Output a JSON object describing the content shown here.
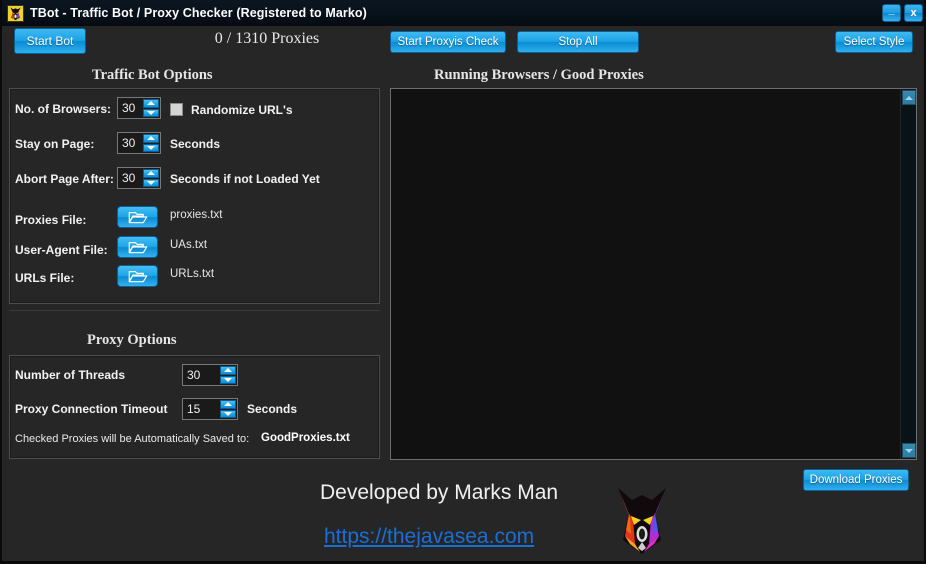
{
  "window": {
    "title": "TBot - Traffic Bot / Proxy Checker (Registered to Marko)",
    "app_icon": "wolf-logo-icon",
    "minimize_label": "_",
    "close_label": "x"
  },
  "toolbar": {
    "start_bot_label": "Start Bot",
    "proxy_counter": "0 / 1310  Proxies",
    "start_proxies_check_label": "Start Proxyis Check",
    "stop_all_label": "Stop All",
    "select_style_label": "Select Style"
  },
  "left_panel": {
    "heading": "Traffic Bot Options",
    "fields": {
      "browsers_label": "No. of Browsers:",
      "browsers_value": "30",
      "randomize_label": "Randomize URL's",
      "randomize_checked": false,
      "stay_on_page_label": "Stay on Page:",
      "stay_on_page_value": "30",
      "stay_on_page_unit": "Seconds",
      "abort_label": "Abort Page After:",
      "abort_value": "30",
      "abort_unit": "Seconds if not Loaded Yet"
    },
    "files": {
      "proxies_label": "Proxies File:",
      "proxies_value": "proxies.txt",
      "useragent_label": "User-Agent  File:",
      "useragent_value": "UAs.txt",
      "urls_label": "URLs  File:",
      "urls_value": "URLs.txt",
      "browse_icon": "open-folder-icon"
    }
  },
  "proxy_options": {
    "heading": "Proxy  Options",
    "threads_label": "Number of Threads",
    "threads_value": "30",
    "timeout_label": "Proxy Connection Timeout",
    "timeout_value": "15",
    "timeout_unit": "Seconds",
    "save_note": "Checked Proxies will be Automatically Saved to:",
    "save_file": "GoodProxies.txt"
  },
  "right_panel": {
    "heading": "Running Browsers / Good Proxies",
    "list_items": [],
    "scroll_up_icon": "triangle-up-icon",
    "scroll_down_icon": "triangle-down-icon"
  },
  "footer": {
    "download_proxies_label": "Download Proxies",
    "developed_by": "Developed by Marks Man",
    "website": "https://thejavasea.com",
    "logo_icon": "wolf-logo-icon"
  },
  "colors": {
    "accent_blue": "#1ba2e6",
    "window_bg": "#262626",
    "titlebar_bg": "#07121c",
    "listbox_bg": "#111111",
    "link_blue": "#1a6fd4",
    "text_primary": "#f2f2f2"
  }
}
